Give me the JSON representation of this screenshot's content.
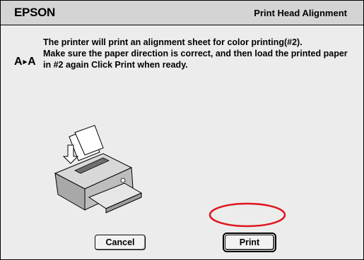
{
  "header": {
    "brand": "EPSON",
    "title": "Print Head Alignment"
  },
  "icon": {
    "name": "aa-alignment-icon",
    "left_glyph": "A",
    "right_glyph": "A",
    "arrow_glyph": "▸"
  },
  "message": {
    "line1": "The printer will print an alignment sheet for color printing(#2).",
    "line2": "Make sure the paper direction is correct, and then load the printed paper in #2 again Click Print when ready."
  },
  "illustration": {
    "name": "printer-with-paper-illustration"
  },
  "buttons": {
    "cancel": "Cancel",
    "print": "Print"
  },
  "annotation": {
    "highlight_color": "#e0141e"
  }
}
